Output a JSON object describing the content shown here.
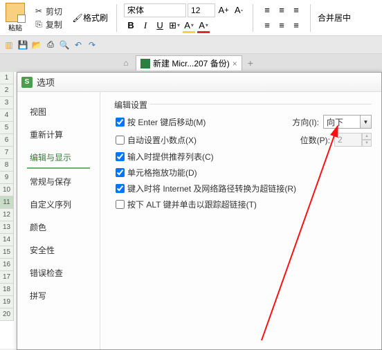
{
  "ribbon": {
    "paste_label": "粘贴",
    "cut_label": "剪切",
    "copy_label": "复制",
    "fmt_painter": "格式刷",
    "font_name": "宋体",
    "font_size": "12",
    "merge_label": "合并居中"
  },
  "tabs": {
    "doc_label": "新建 Micr...207 备份)"
  },
  "rows": [
    "1",
    "2",
    "3",
    "4",
    "5",
    "6",
    "7",
    "8",
    "9",
    "10",
    "11",
    "12",
    "13",
    "14",
    "15",
    "16",
    "17",
    "18",
    "19",
    "20"
  ],
  "dialog": {
    "title": "选项",
    "nav": {
      "view": "视图",
      "recalc": "重新计算",
      "edit_display": "编辑与显示",
      "general_save": "常规与保存",
      "custom_list": "自定义序列",
      "color": "颜色",
      "security": "安全性",
      "error_check": "错误检查",
      "spell": "拼写"
    },
    "section_title": "编辑设置",
    "opts": {
      "enter_move": "按 Enter 键后移动(M)",
      "direction_label": "方向(I):",
      "direction_value": "向下",
      "auto_decimal": "自动设置小数点(X)",
      "places_label": "位数(P):",
      "places_value": "2",
      "recommend_list": "输入时提供推荐列表(C)",
      "drag_fill": "单元格拖放功能(D)",
      "internet_link": "键入时将 Internet 及网络路径转换为超链接(R)",
      "alt_click": "按下 ALT 键并单击以跟踪超链接(T)"
    }
  }
}
